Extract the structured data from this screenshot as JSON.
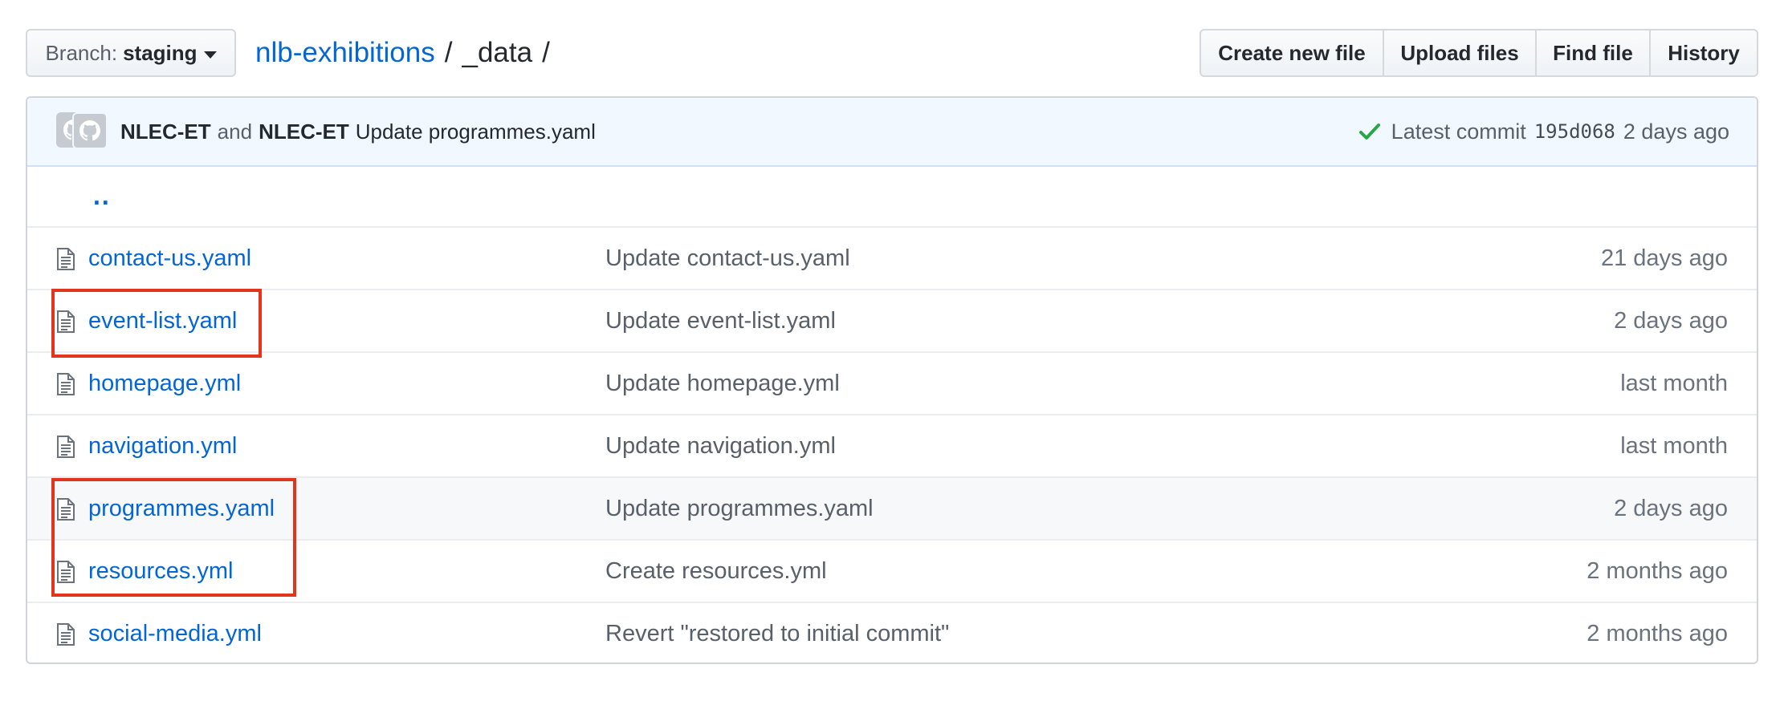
{
  "branch": {
    "label": "Branch:",
    "value": "staging"
  },
  "breadcrumb": {
    "repo": "nlb-exhibitions",
    "sep1": "/",
    "current": "_data",
    "sep2": "/"
  },
  "actions": {
    "create_new_file": "Create new file",
    "upload_files": "Upload files",
    "find_file": "Find file",
    "history": "History"
  },
  "commit": {
    "author1": "NLEC-ET",
    "conj": "and",
    "author2": "NLEC-ET",
    "message": "Update programmes.yaml",
    "latest_label": "Latest commit",
    "sha": "195d068",
    "age": "2 days ago",
    "status_color": "#28a745"
  },
  "parent_dir": "..",
  "files": [
    {
      "name": "contact-us.yaml",
      "message": "Update contact-us.yaml",
      "age": "21 days ago"
    },
    {
      "name": "event-list.yaml",
      "message": "Update event-list.yaml",
      "age": "2 days ago"
    },
    {
      "name": "homepage.yml",
      "message": "Update homepage.yml",
      "age": "last month"
    },
    {
      "name": "navigation.yml",
      "message": "Update navigation.yml",
      "age": "last month"
    },
    {
      "name": "programmes.yaml",
      "message": "Update programmes.yaml",
      "age": "2 days ago"
    },
    {
      "name": "resources.yml",
      "message": "Create resources.yml",
      "age": "2 months ago"
    },
    {
      "name": "social-media.yml",
      "message": "Revert \"restored to initial commit\"",
      "age": "2 months ago"
    }
  ],
  "colors": {
    "link": "#0366d6",
    "annotation": "#e3341e"
  }
}
